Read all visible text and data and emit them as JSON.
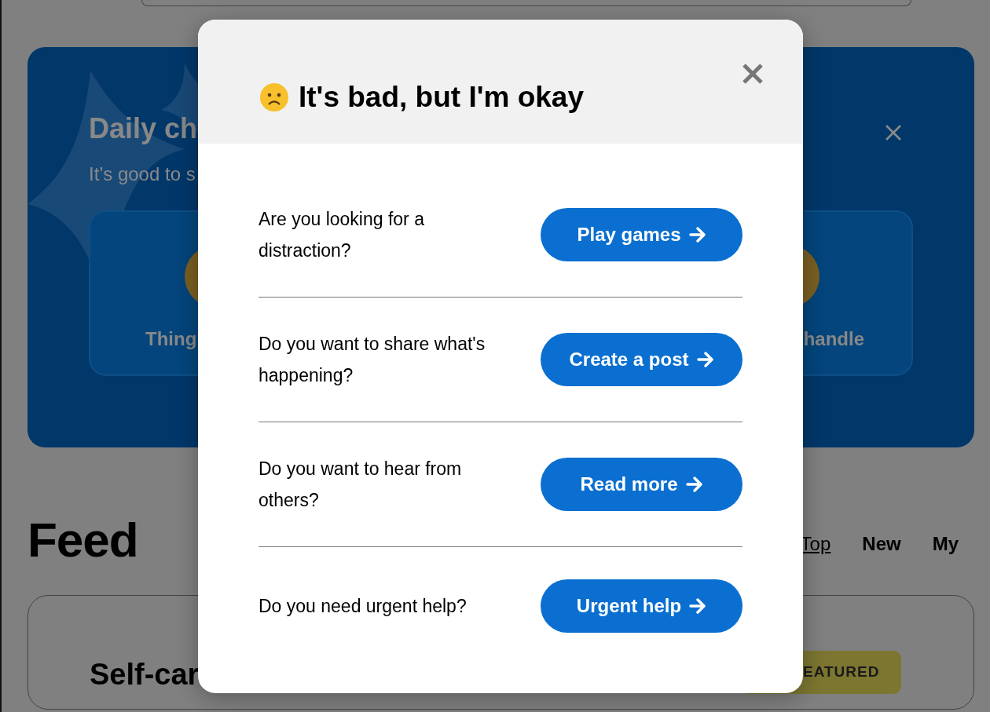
{
  "daily_check": {
    "title": "Daily ch",
    "subtitle": "It’s good to s",
    "options": [
      {
        "label": "Thing"
      },
      {
        "label": "handle"
      }
    ]
  },
  "feed": {
    "title": "Feed",
    "tabs": [
      {
        "label": "Top",
        "selected": true
      },
      {
        "label": "New",
        "selected": false
      },
      {
        "label": "My",
        "selected": false
      }
    ],
    "posts": [
      {
        "title": "Self-car",
        "badge": "EATURED"
      }
    ]
  },
  "modal": {
    "title": "It's bad, but I'm okay",
    "rows": [
      {
        "question": "Are you looking for a distraction?",
        "button": "Play games"
      },
      {
        "question": "Do you want to share what's happening?",
        "button": "Create a post"
      },
      {
        "question": "Do you want to hear from others?",
        "button": "Read more"
      },
      {
        "question": "Do you need urgent help?",
        "button": "Urgent help"
      }
    ]
  }
}
